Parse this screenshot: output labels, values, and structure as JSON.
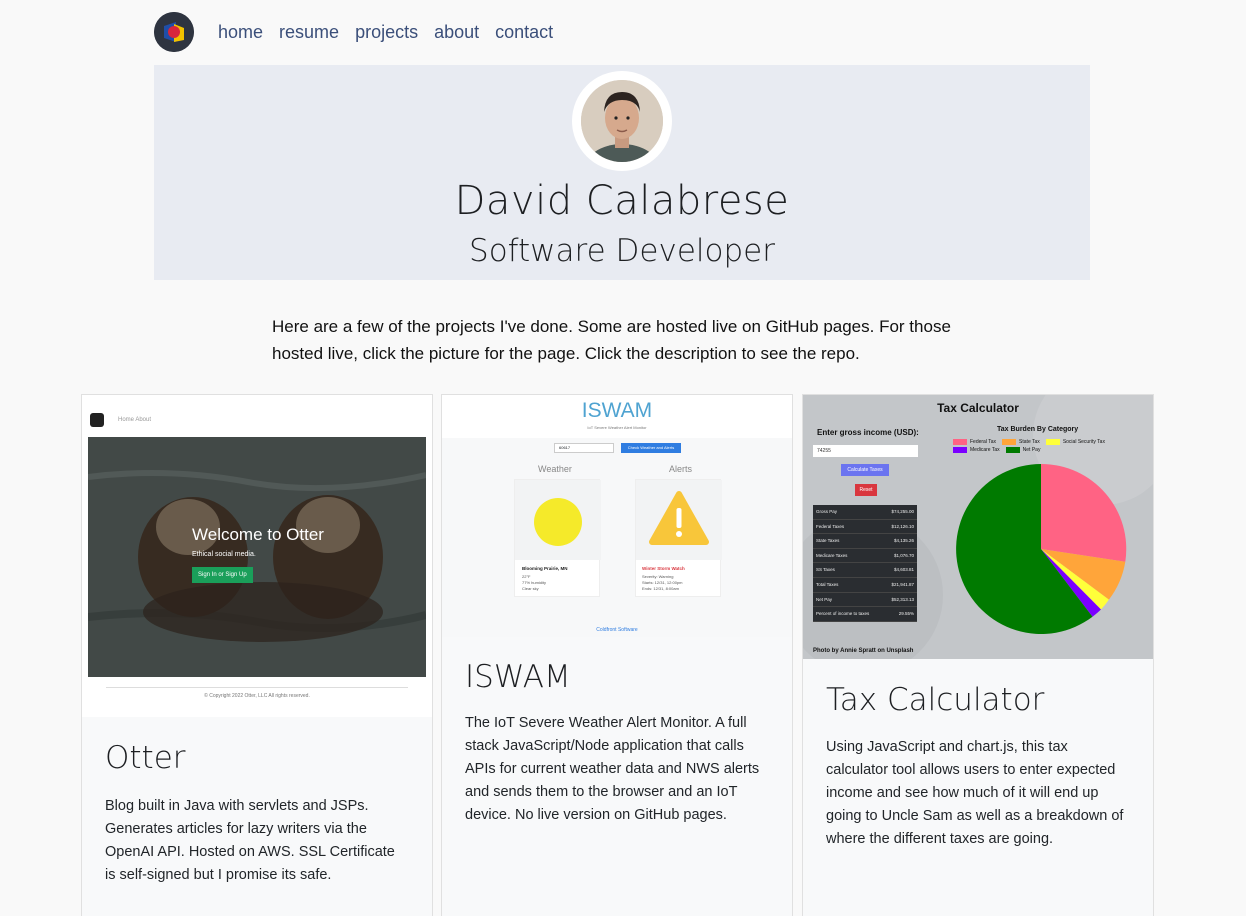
{
  "nav": {
    "items": [
      "home",
      "resume",
      "projects",
      "about",
      "contact"
    ]
  },
  "hero": {
    "name": "David Calabrese",
    "title": "Software Developer"
  },
  "intro": "Here are a few of the projects I've done. Some are hosted live on GitHub pages. For those hosted live, click the picture for the page. Click the description to see the repo.",
  "projects": [
    {
      "title": "Otter",
      "description": "Blog built in Java with servlets and JSPs. Generates articles for lazy writers via the OpenAI API. Hosted on AWS. SSL Certificate is self-signed but I promise its safe.",
      "screenshot": {
        "nav": "Home   About",
        "welcome": "Welcome to Otter",
        "tagline": "Ethical social media.",
        "button": "Sign In or Sign Up",
        "footer": "© Copyright 2022 Otter, LLC All rights reserved."
      }
    },
    {
      "title": "ISWAM",
      "description": "The IoT Severe Weather Alert Monitor. A full stack JavaScript/Node application that calls APIs for current weather data and NWS alerts and sends them to the browser and an IoT device. No live version on GitHub pages.",
      "screenshot": {
        "heading": "ISWAM",
        "subheading": "IoT Severe Weather Alert Monitor",
        "zip": "60617",
        "button": "Check Weather and Alerts",
        "weather_label": "Weather",
        "alerts_label": "Alerts",
        "location": "Blooming Prairie, MN",
        "temp": "22°F",
        "humidity": "77% humidity",
        "condition": "Clear sky",
        "alert_title": "Winter Storm Watch",
        "alert_severity": "Severity: Warning",
        "alert_starts": "Starts: 12/31, 12:00pm",
        "alert_ends": "Ends: 12/31, 8:00am",
        "link": "Coldfront Software"
      }
    },
    {
      "title": "Tax Calculator",
      "description": "Using JavaScript and chart.js, this tax calculator tool allows users to enter expected income and see how much of it will end up going to Uncle Sam as well as a breakdown of where the different taxes are going.",
      "screenshot": {
        "heading": "Tax Calculator",
        "income_label": "Enter gross income (USD):",
        "income_value": "74255",
        "calc_button": "Calculate Taxes",
        "reset_button": "Reset",
        "chart_title": "Tax Burden By Category",
        "legend": [
          {
            "name": "Federal Tax",
            "color": "#ff6384"
          },
          {
            "name": "State Tax",
            "color": "#ffa53a"
          },
          {
            "name": "Social Security Tax",
            "color": "#ffff3a"
          },
          {
            "name": "Medicare Tax",
            "color": "#7b00ff"
          },
          {
            "name": "Net Pay",
            "color": "#007a00"
          }
        ],
        "table": [
          [
            "Gross Pay",
            "$74,255.00"
          ],
          [
            "Federal Taxes",
            "$12,126.10"
          ],
          [
            "State Taxes",
            "$4,135.26"
          ],
          [
            "Medicare Taxes",
            "$1,076.70"
          ],
          [
            "SS Taxes",
            "$4,603.81"
          ],
          [
            "Total Taxes",
            "$21,941.87"
          ],
          [
            "Net Pay",
            "$52,313.13"
          ],
          [
            "Percent of income to taxes",
            "29.55%"
          ]
        ],
        "credit": "Photo by Annie Spratt on Unsplash"
      }
    }
  ],
  "colors": {
    "page_bg": "#f9f9f9",
    "hero_bg": "#e8ebf2",
    "nav_link": "#3b4f7a"
  }
}
